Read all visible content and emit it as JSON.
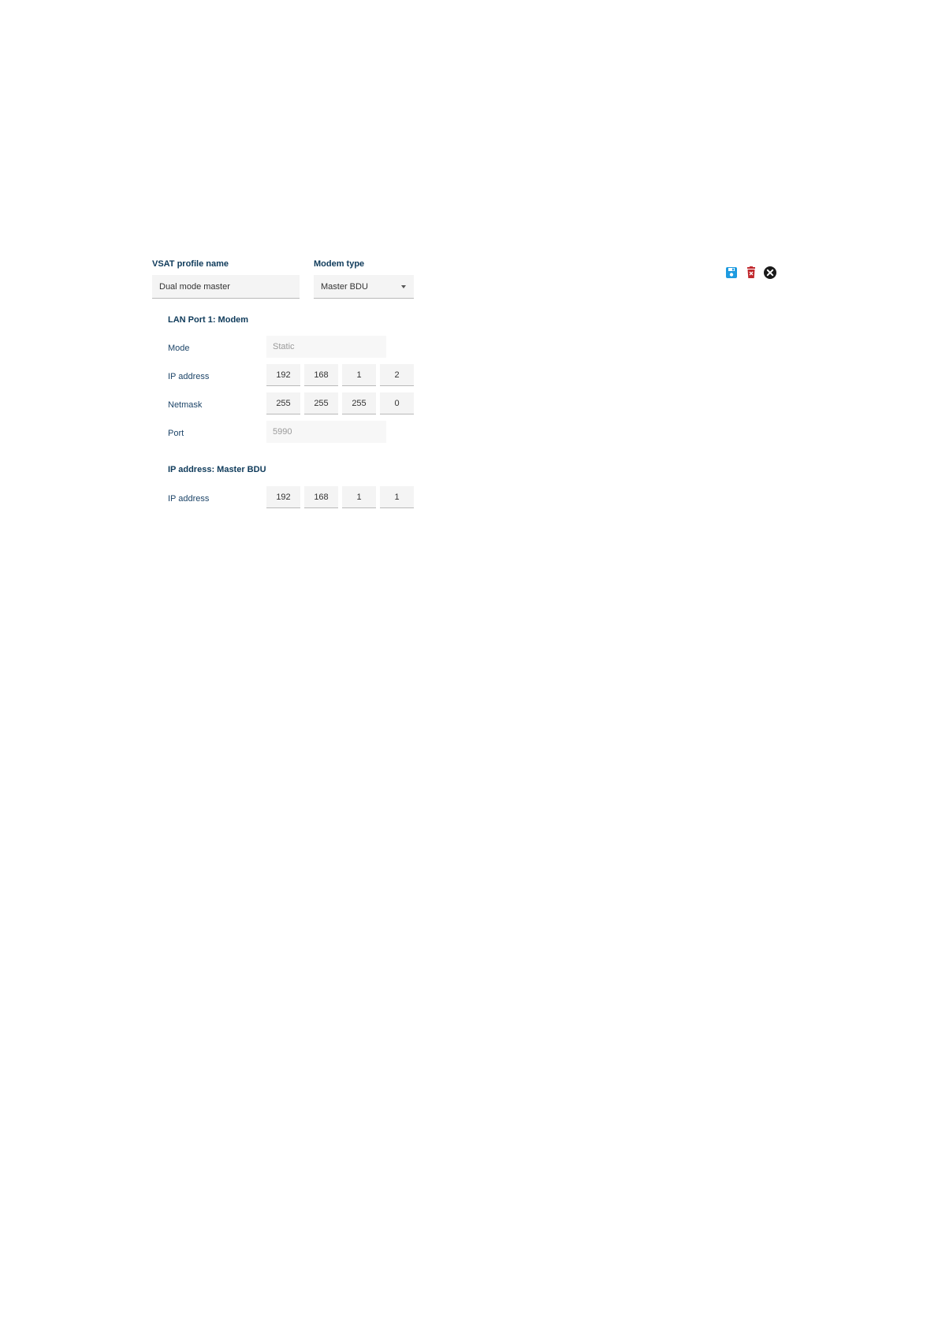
{
  "profile": {
    "name_label": "VSAT profile name",
    "name_value": "Dual mode master",
    "modem_label": "Modem type",
    "modem_value": "Master BDU"
  },
  "toolbar": {
    "icons": [
      "save-icon",
      "delete-icon",
      "close-icon"
    ],
    "colors": {
      "save": "#1e9be0",
      "delete": "#c0282d",
      "close": "#1a1a1a"
    }
  },
  "lan_port": {
    "title": "LAN Port 1: Modem",
    "mode_label": "Mode",
    "mode_value": "Static",
    "ip_label": "IP address",
    "ip": [
      "192",
      "168",
      "1",
      "2"
    ],
    "netmask_label": "Netmask",
    "netmask": [
      "255",
      "255",
      "255",
      "0"
    ],
    "port_label": "Port",
    "port_value": "5990"
  },
  "master_bdu": {
    "title": "IP address: Master BDU",
    "ip_label": "IP address",
    "ip": [
      "192",
      "168",
      "1",
      "1"
    ]
  }
}
